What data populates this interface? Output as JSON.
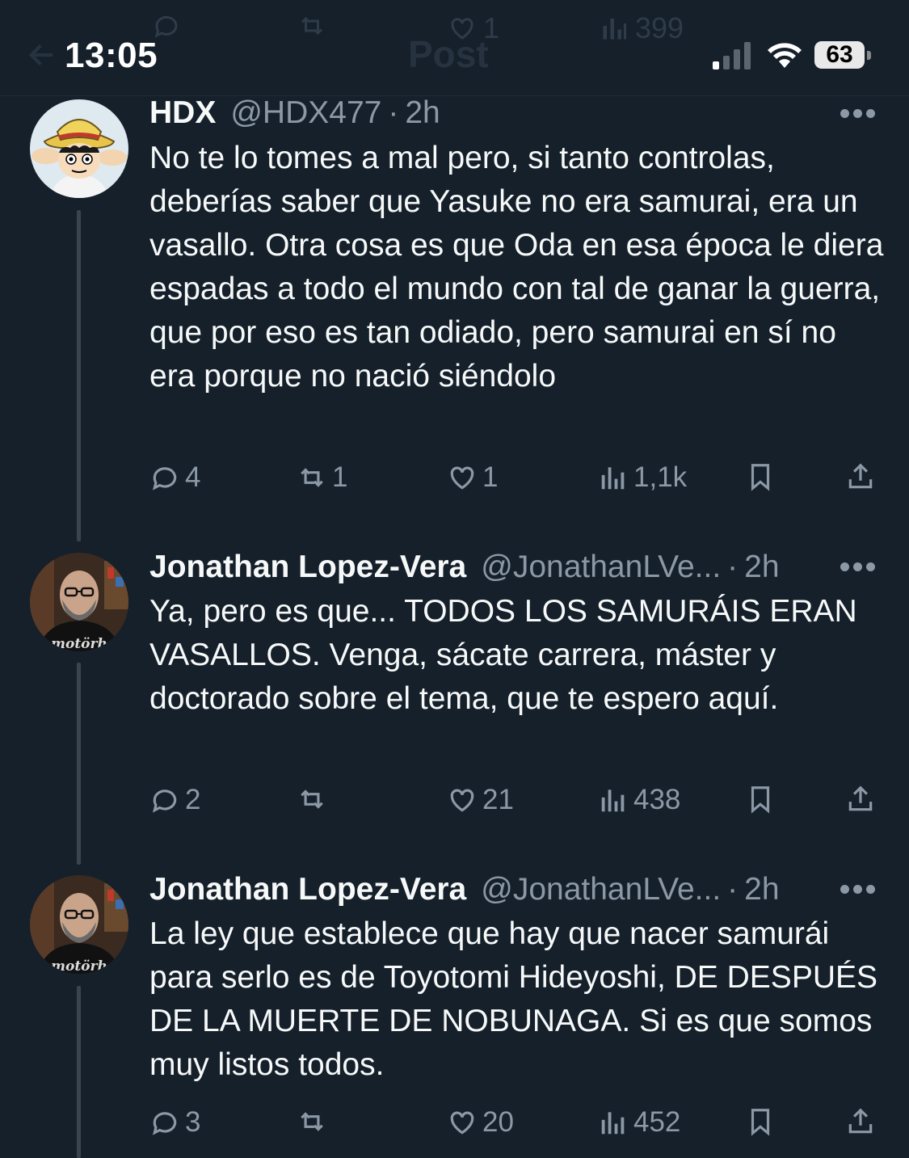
{
  "status_bar": {
    "time": "13:05",
    "battery": "63"
  },
  "header_ghost": {
    "title": "Post",
    "reply": "",
    "like": "1",
    "views": "399"
  },
  "tweets": [
    {
      "name": "HDX",
      "handle": "@HDX477",
      "time": "2h",
      "text": "No te lo tomes a mal pero, si tanto controlas, deberías saber que Yasuke no era samurai, era un vasallo. Otra cosa es que Oda en esa época le diera espadas a todo el mundo con tal de ganar la guerra, que por eso es tan odiado, pero samurai en sí no era porque no nació siéndolo",
      "replies": "4",
      "retweets": "1",
      "likes": "1",
      "views": "1,1k"
    },
    {
      "name": "Jonathan Lopez-Vera",
      "handle": "@JonathanLVe...",
      "time": "2h",
      "text": "Ya, pero es que... TODOS LOS SAMURÁIS ERAN VASALLOS. Venga, sácate carrera, máster y doctorado sobre el tema, que te espero aquí.",
      "replies": "2",
      "retweets": "",
      "likes": "21",
      "views": "438"
    },
    {
      "name": "Jonathan Lopez-Vera",
      "handle": "@JonathanLVe...",
      "time": "2h",
      "text": "La ley que establece que hay que nacer samurái para serlo es de Toyotomi Hideyoshi, DE DESPUÉS DE LA MUERTE DE NOBUNAGA. Si es que somos muy listos todos.",
      "replies": "3",
      "retweets": "",
      "likes": "20",
      "views": "452"
    }
  ],
  "shirt_text": "motörhe",
  "colors": {
    "bg": "#15202b",
    "text": "#f7f9f9",
    "muted": "#8b98a5",
    "line": "#3a4450"
  }
}
